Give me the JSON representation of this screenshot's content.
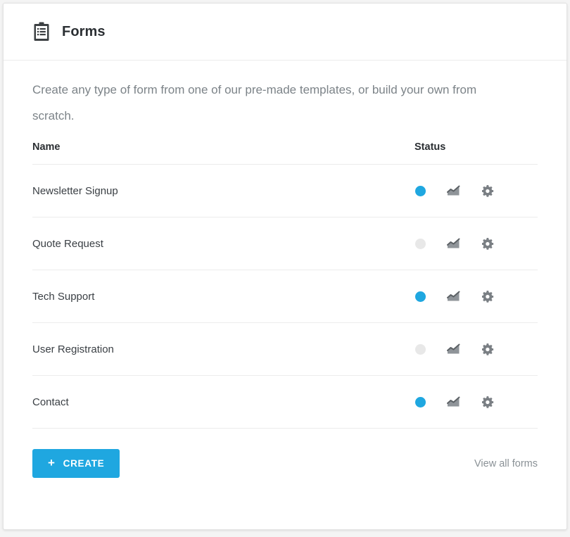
{
  "header": {
    "icon": "clipboard-list-icon",
    "title": "Forms"
  },
  "intro": "Create any type of form from one of our pre-made templates, or build your own from scratch.",
  "table": {
    "columns": [
      "Name",
      "Status"
    ],
    "rows": [
      {
        "name": "Newsletter Signup",
        "status": "active",
        "stats_icon": "chart-icon",
        "settings_icon": "gear-icon"
      },
      {
        "name": "Quote Request",
        "status": "inactive",
        "stats_icon": "chart-icon",
        "settings_icon": "gear-icon"
      },
      {
        "name": "Tech Support",
        "status": "active",
        "stats_icon": "chart-icon",
        "settings_icon": "gear-icon"
      },
      {
        "name": "User Registration",
        "status": "inactive",
        "stats_icon": "chart-icon",
        "settings_icon": "gear-icon"
      },
      {
        "name": "Contact",
        "status": "active",
        "stats_icon": "chart-icon",
        "settings_icon": "gear-icon"
      }
    ]
  },
  "footer": {
    "create_label": "CREATE",
    "create_icon": "plus-icon",
    "view_all_label": "View all forms"
  },
  "colors": {
    "accent": "#1fa7e0",
    "status_active": "#1fa7e0",
    "status_inactive": "#e8e8e8",
    "icon_gray": "#7a7f84",
    "text_primary": "#2b2f33",
    "text_secondary": "#7c8388",
    "divider": "#ececec"
  }
}
